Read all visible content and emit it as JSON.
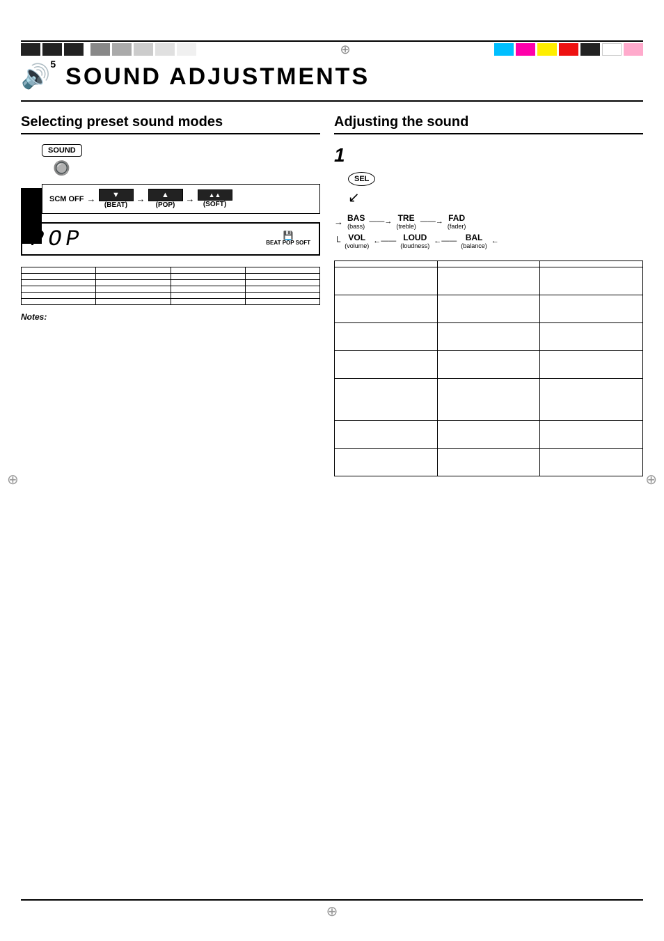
{
  "page": {
    "background": "#ffffff"
  },
  "topBar": {
    "crosshair": "⊕"
  },
  "chapter": {
    "icon": "🔊",
    "number": "5",
    "title": "SOUND ADJUSTMENTS"
  },
  "leftSection": {
    "header": "Selecting preset sound modes",
    "soundButton": "SOUND",
    "scmOff": "SCM OFF",
    "arrow": "→",
    "modes": [
      {
        "id": "beat",
        "label": "(BEAT)"
      },
      {
        "id": "pop",
        "label": "(POP)"
      },
      {
        "id": "soft",
        "label": "(SOFT)"
      }
    ],
    "displayText": "POP",
    "displayIndicator": "BEAT POP SOFT",
    "table": {
      "headers": [
        "",
        "",
        "",
        ""
      ],
      "rows": [
        [
          "",
          "",
          "",
          ""
        ],
        [
          "",
          "",
          "",
          ""
        ],
        [
          "",
          "",
          "",
          ""
        ],
        [
          "",
          "",
          "",
          ""
        ],
        [
          "",
          "",
          "",
          ""
        ]
      ]
    },
    "notes": {
      "label": "Notes:",
      "text": ""
    }
  },
  "rightSection": {
    "header": "Adjusting the sound",
    "stepNumber": "1",
    "selButton": "SEL",
    "flow": {
      "row1": [
        {
          "name": "BAS",
          "sub": "(bass)"
        },
        {
          "name": "TRE",
          "sub": "(treble)"
        },
        {
          "name": "FAD",
          "sub": "(fader)"
        }
      ],
      "row2": [
        {
          "name": "VOL",
          "sub": "(volume)"
        },
        {
          "name": "LOUD",
          "sub": "(loudness)"
        },
        {
          "name": "BAL",
          "sub": "(balance)"
        }
      ]
    },
    "table": {
      "headers": [
        "",
        "",
        ""
      ],
      "rows": [
        [
          "",
          "",
          ""
        ],
        [
          "",
          "",
          ""
        ],
        [
          "",
          "",
          ""
        ],
        [
          "",
          "",
          ""
        ],
        [
          "",
          "",
          ""
        ],
        [
          "",
          "",
          ""
        ],
        [
          "",
          "",
          ""
        ]
      ]
    }
  },
  "bottomCrosshair": "⊕",
  "leftCrosshair": "⊕",
  "rightCrosshair": "⊕"
}
